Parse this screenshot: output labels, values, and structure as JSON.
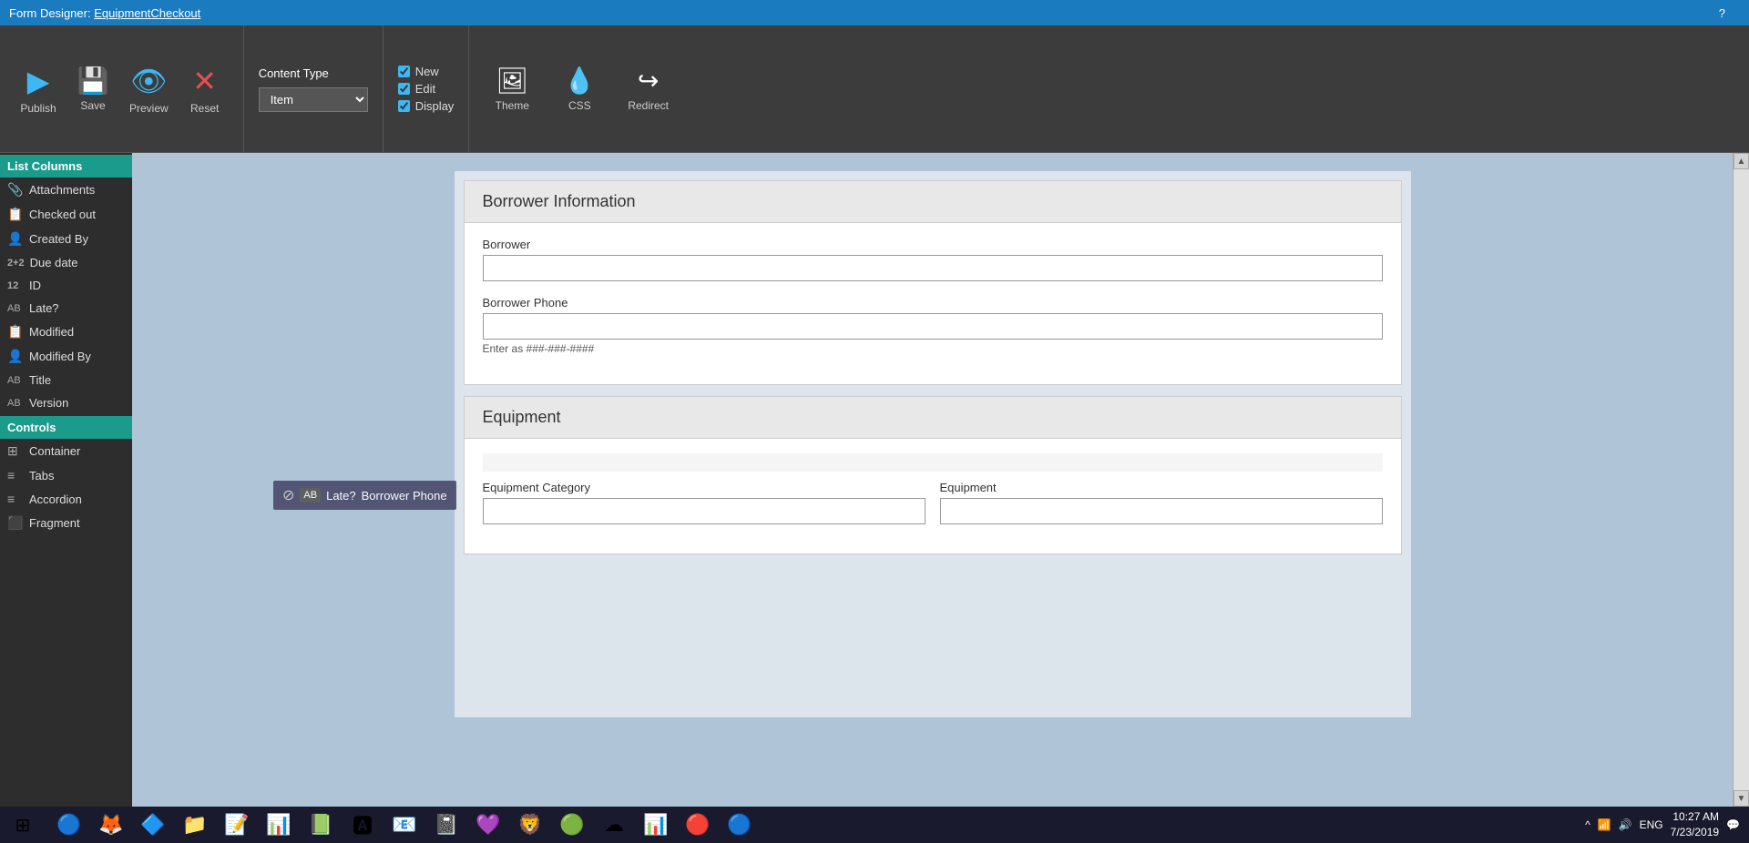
{
  "titleBar": {
    "prefix": "Form Designer:",
    "link": "EquipmentCheckout",
    "helpIcon": "?"
  },
  "toolbar": {
    "publish": {
      "label": "Publish",
      "icon": "▶"
    },
    "save": {
      "label": "Save",
      "icon": "💾"
    },
    "preview": {
      "label": "Preview",
      "icon": "👁"
    },
    "reset": {
      "label": "Reset",
      "icon": "✕"
    },
    "contentType": {
      "label": "Content Type",
      "options": [
        "Item"
      ],
      "selected": "Item"
    },
    "checkboxes": [
      {
        "id": "cb-new",
        "label": "New",
        "checked": true
      },
      {
        "id": "cb-edit",
        "label": "Edit",
        "checked": true
      },
      {
        "id": "cb-display",
        "label": "Display",
        "checked": true
      }
    ],
    "theme": {
      "label": "Theme",
      "icon": "🖼"
    },
    "css": {
      "label": "CSS",
      "icon": "💧"
    },
    "redirect": {
      "label": "Redirect",
      "icon": "↪"
    }
  },
  "sidebar": {
    "listColumnsHeader": "List Columns",
    "items": [
      {
        "id": "attachments",
        "icon": "📎",
        "label": "Attachments"
      },
      {
        "id": "checked-out",
        "icon": "📋",
        "label": "Checked out"
      },
      {
        "id": "created-by",
        "icon": "👤",
        "label": "Created By"
      },
      {
        "id": "due-date",
        "icon": "2+2",
        "label": "Due date"
      },
      {
        "id": "id",
        "icon": "12",
        "label": "ID"
      },
      {
        "id": "late",
        "icon": "AB",
        "label": "Late?"
      },
      {
        "id": "modified",
        "icon": "📋",
        "label": "Modified"
      },
      {
        "id": "modified-by",
        "icon": "👤",
        "label": "Modified By"
      },
      {
        "id": "title",
        "icon": "AB",
        "label": "Title"
      },
      {
        "id": "version",
        "icon": "AB",
        "label": "Version"
      }
    ],
    "controlsHeader": "Controls",
    "controls": [
      {
        "id": "container",
        "icon": "⊞",
        "label": "Container"
      },
      {
        "id": "tabs",
        "icon": "≡",
        "label": "Tabs"
      },
      {
        "id": "accordion",
        "icon": "≡",
        "label": "Accordion"
      },
      {
        "id": "fragment",
        "icon": "⬛",
        "label": "Fragment"
      }
    ]
  },
  "form": {
    "sections": [
      {
        "id": "borrower-info",
        "title": "Borrower Information",
        "fields": [
          {
            "id": "borrower",
            "label": "Borrower",
            "type": "text",
            "value": "",
            "placeholder": ""
          },
          {
            "id": "borrower-phone",
            "label": "Borrower Phone",
            "type": "text",
            "value": "",
            "placeholder": "",
            "hint": "Enter as ###-###-####"
          }
        ]
      },
      {
        "id": "equipment",
        "title": "Equipment",
        "fields": [
          {
            "id": "equipment-category",
            "label": "Equipment Category",
            "type": "text",
            "value": ""
          },
          {
            "id": "equipment",
            "label": "Equipment",
            "type": "text",
            "value": ""
          }
        ]
      }
    ]
  },
  "dragTooltip": {
    "text": "Late?",
    "icon": "⊘"
  },
  "taskbar": {
    "apps": [
      {
        "id": "chrome",
        "icon": "🔵"
      },
      {
        "id": "firefox",
        "icon": "🦊"
      },
      {
        "id": "ie-app",
        "icon": "🔷"
      },
      {
        "id": "files",
        "icon": "📁"
      },
      {
        "id": "word",
        "icon": "📝"
      },
      {
        "id": "powerpoint",
        "icon": "📊"
      },
      {
        "id": "excel",
        "icon": "📗"
      },
      {
        "id": "adobe",
        "icon": "🅰"
      },
      {
        "id": "mail",
        "icon": "📧"
      },
      {
        "id": "onenote",
        "icon": "📓"
      },
      {
        "id": "teams",
        "icon": "💜"
      },
      {
        "id": "brave",
        "icon": "🦁"
      },
      {
        "id": "spotify",
        "icon": "🟢"
      },
      {
        "id": "cloud1",
        "icon": "☁"
      },
      {
        "id": "smartsheet",
        "icon": "📊"
      },
      {
        "id": "stb",
        "icon": "🔴"
      },
      {
        "id": "ie2",
        "icon": "🔵"
      }
    ],
    "systemIcons": [
      "^",
      "🔊",
      "📶",
      "🔔"
    ],
    "time": "10:27 AM",
    "date": "7/23/2019",
    "lang": "ENG"
  }
}
